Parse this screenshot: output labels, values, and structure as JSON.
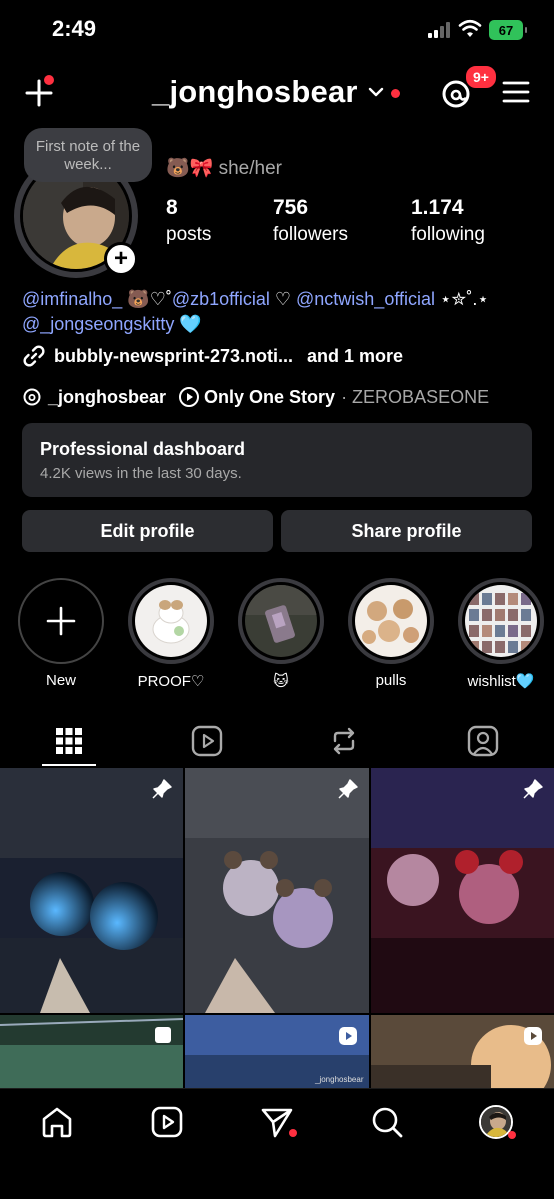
{
  "status_bar": {
    "time": "2:49",
    "battery": "67"
  },
  "header": {
    "username": "_jonghosbear",
    "threads_badge": "9+"
  },
  "profile": {
    "note": "First note of the week...",
    "pronouns": "🐻🎀 she/her",
    "stats": [
      {
        "value": "8",
        "label": "posts"
      },
      {
        "value": "756",
        "label": "followers"
      },
      {
        "value": "1.174",
        "label": "following"
      }
    ],
    "bio": {
      "mention1": "@imfinalho_",
      "text1": " 🐻♡˚",
      "mention2": "@zb1official",
      "text2": " ♡ ",
      "mention3": "@nctwish_official",
      "text3": " ⋆✮˚.⋆",
      "mention4": "@_jongseongskitty",
      "text4": " 🩵"
    },
    "link": "bubbly-newsprint-273.noti...",
    "link_more": "and 1 more",
    "threads_handle": "_jonghosbear",
    "song": "Only One Story",
    "artist": "· ZEROBASEONE"
  },
  "dashboard": {
    "title": "Professional dashboard",
    "subtitle": "4.2K views in the last 30 days."
  },
  "buttons": {
    "edit": "Edit profile",
    "share": "Share profile"
  },
  "highlights": [
    {
      "label": "New"
    },
    {
      "label": "PROOF♡"
    },
    {
      "label": "🐱"
    },
    {
      "label": "pulls"
    },
    {
      "label": "wishlist🩵"
    }
  ],
  "tabs": [
    "grid-tab",
    "reels-tab",
    "reposts-tab",
    "tagged-tab"
  ],
  "grid": {
    "watermark": "_jonghosbear"
  },
  "colors": {
    "accent": "#ff3040",
    "mention": "#8fa6ff",
    "surface": "#26272b"
  }
}
